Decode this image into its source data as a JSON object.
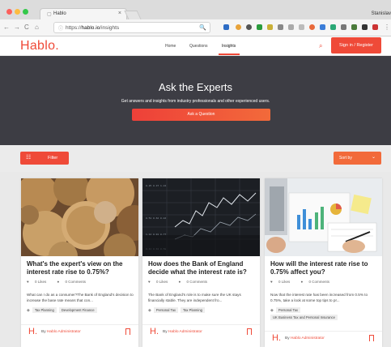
{
  "browser": {
    "tab_title": "Hablo",
    "tab_close": "×",
    "user": "Stanislav",
    "url_prefix": "https://",
    "url_domain": "hablo.io",
    "url_path": "/insights"
  },
  "header": {
    "logo": "Hablo.",
    "nav": [
      "Home",
      "Questions",
      "Insights"
    ],
    "signin": "Sign in / Register"
  },
  "hero": {
    "title": "Ask the Experts",
    "subtitle": "Get answers and insights from industry professionals and other experienced users.",
    "button": "Ask a Question"
  },
  "toolbar": {
    "filter": "Filter",
    "sort": "Sort by"
  },
  "cards": [
    {
      "title": "What's the expert's view on the interest rate rise to 0.75%?",
      "likes": "0 Likes",
      "comments": "0 Comments",
      "excerpt": "What can I do as a consumer?The Bank of England's decision to increase the base rate means that con...",
      "tags": [
        "Tax Planning",
        "Development Finance"
      ],
      "author_prefix": "By",
      "author": "Hablo Administrator"
    },
    {
      "title": "How does the Bank of England decide what the interest rate is?",
      "likes": "0 Likes",
      "comments": "0 Comments",
      "excerpt": "The Bank of England's role is to make sure the UK stays financially stable. They are independent fro...",
      "tags": [
        "Personal Tax",
        "Tax Planning"
      ],
      "author_prefix": "By",
      "author": "Hablo Administrator"
    },
    {
      "title": "How will the interest rate rise to 0.75% affect you?",
      "likes": "0 Likes",
      "comments": "0 Comments",
      "excerpt": "Now that the interest rate has been increased from 0.5% to 0.75%, take a look at some top tips to pr...",
      "tags": [
        "Personal Tax",
        "UK Business Tax and Personal Insurance"
      ],
      "author_prefix": "By",
      "author": "Hablo Administrator"
    }
  ],
  "colors": {
    "brand": "#ef4a38",
    "hero_bg": "#3d3d44",
    "accent": "#f26a3a"
  }
}
